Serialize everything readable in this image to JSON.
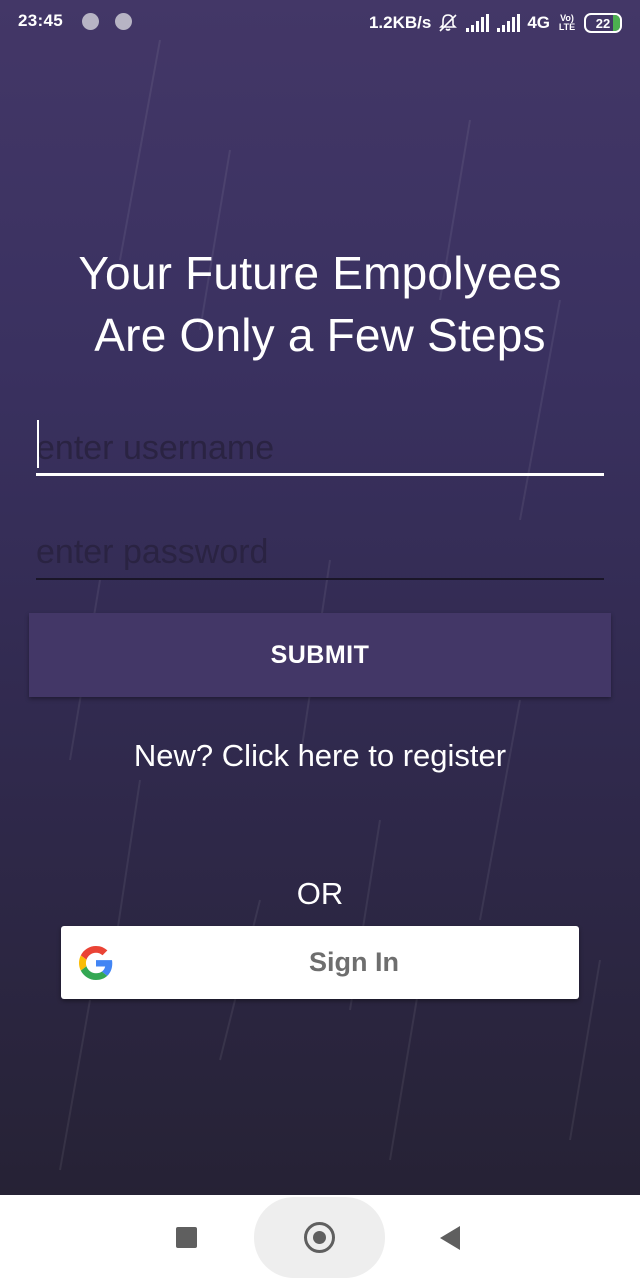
{
  "status_bar": {
    "time": "23:45",
    "net_speed": "1.2KB/s",
    "network_type": "4G",
    "volte_top": "Vo)",
    "volte_bottom": "LTE",
    "battery_level": "22",
    "battery_fraction": 0.22,
    "icons": [
      "notification-dot-icon",
      "notification-dot-icon",
      "bell-off-icon",
      "signal-icon",
      "signal-icon",
      "battery-icon"
    ]
  },
  "headline": {
    "line1": "Your Future Empolyees",
    "line2": "Are Only a Few Steps"
  },
  "login_form": {
    "username_placeholder": "enter username",
    "password_placeholder": "enter password",
    "submit_label": "SUBMIT",
    "register_text": "New? Click here to register",
    "or_text": "OR",
    "google_sign_in_label": "Sign In"
  },
  "nav_bar": {
    "icons": [
      "recents-icon",
      "home-icon",
      "back-icon"
    ]
  },
  "colors": {
    "background_top": "#433767",
    "background_bottom": "#262235",
    "submit_button": "#433767",
    "battery_fill": "#4caf50"
  }
}
